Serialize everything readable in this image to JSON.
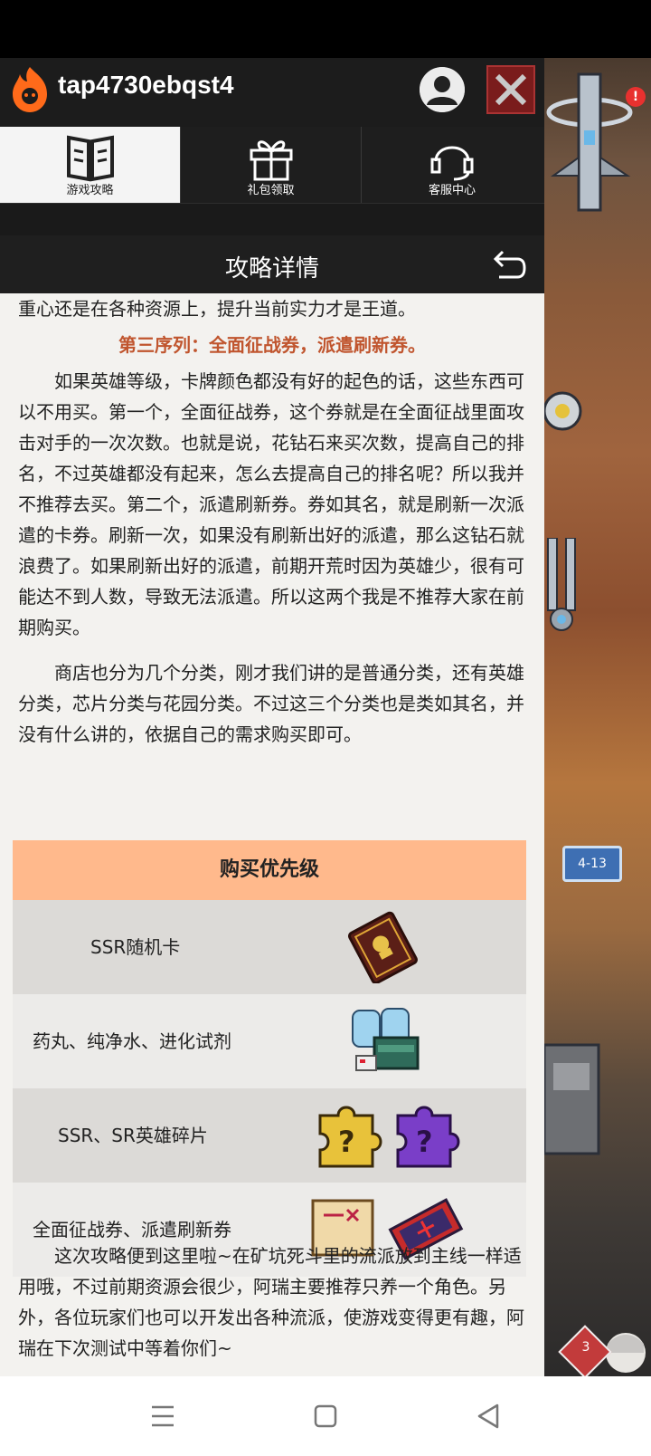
{
  "header": {
    "username": "tap4730ebqst4"
  },
  "tabs": [
    {
      "label": "游戏攻略",
      "active": true
    },
    {
      "label": "礼包领取",
      "active": false
    },
    {
      "label": "客服中心",
      "active": false
    }
  ],
  "page_title": "攻略详情",
  "content": {
    "intro_line": "重心还是在各种资源上，提升当前实力才是王道。",
    "sequence3_title": "第三序列：全面征战券，派遣刷新券。",
    "para1": "如果英雄等级，卡牌颜色都没有好的起色的话，这些东西可以不用买。第一个，全面征战券，这个券就是在全面征战里面攻击对手的一次次数。也就是说，花钻石来买次数，提高自己的排名，不过英雄都没有起来，怎么去提高自己的排名呢？所以我并不推荐去买。第二个，派遣刷新券。券如其名，就是刷新一次派遣的卡券。刷新一次，如果没有刷新出好的派遣，那么这钻石就浪费了。如果刷新出好的派遣，前期开荒时因为英雄少，很有可能达不到人数，导致无法派遣。所以这两个我是不推荐大家在前期购买。",
    "para2": "商店也分为几个分类，刚才我们讲的是普通分类，还有英雄分类，芯片分类与花园分类。不过这三个分类也是类如其名，并没有什么讲的，依据自己的需求购买即可。",
    "outro": "这次攻略便到这里啦~在矿坑死斗里的流派放到主线一样适用哦，不过前期资源会很少，阿瑞主要推荐只养一个角色。另外，各位玩家们也可以开发出各种流派，使游戏变得更有趣，阿瑞在下次测试中等着你们~"
  },
  "priority_table": {
    "title": "购买优先级",
    "rows": [
      {
        "name": "SSR随机卡",
        "icon": "ssr-card-icon"
      },
      {
        "name": "药丸、纯净水、进化试剂",
        "icon": "supplies-icon"
      },
      {
        "name": "SSR、SR英雄碎片",
        "icon": "hero-shard-icon"
      },
      {
        "name": "全面征战券、派遣刷新券",
        "icon": "ticket-icon"
      }
    ]
  },
  "game": {
    "level_badge": "4-13",
    "alert_count": "!",
    "dice_value": "3"
  },
  "colors": {
    "table_header": "#ffb98c",
    "sequence_title": "#c0552e"
  }
}
